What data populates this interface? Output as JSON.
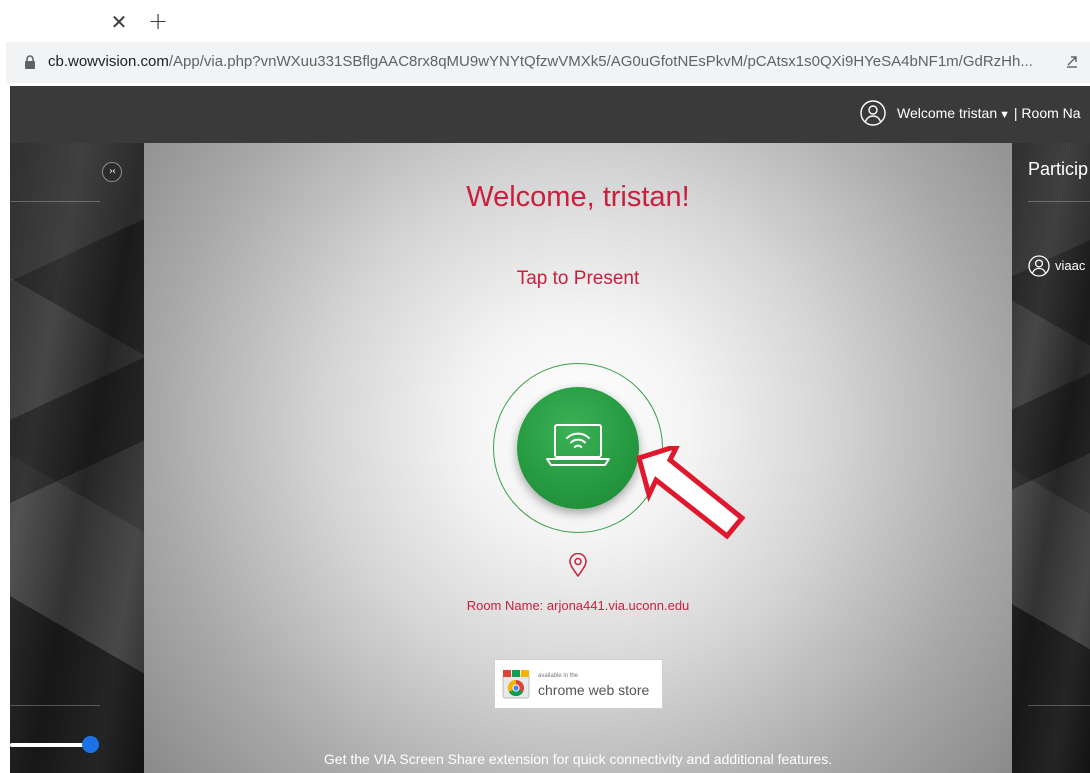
{
  "browser": {
    "url_host": "cb.wowvision.com",
    "url_path": "/App/via.php?vnWXuu331SBflgAAC8rx8qMU9wYNYtQfzwVMXk5/AG0uGfotNEsPkvM/pCAtsx1s0QXi9HYeSA4bNF1m/GdRzHh..."
  },
  "header": {
    "welcome_text": "Welcome  tristan",
    "room_text": "| Room Na"
  },
  "participants": {
    "title": "Particip",
    "items": [
      "viaac"
    ]
  },
  "main": {
    "welcome_title": "Welcome, tristan!",
    "tap_label": "Tap to Present",
    "room_name": "Room Name: arjona441.via.uconn.edu",
    "badge_small": "available in the",
    "badge_big": "chrome web store",
    "footer_note": "Get the VIA Screen Share extension for quick connectivity and additional features."
  },
  "colors": {
    "accent_red": "#c8203e",
    "present_green": "#269b42",
    "slider_blue": "#1a73e8",
    "header_bg": "#3a3a3a"
  },
  "volume_slider": {
    "value_fraction": 0.9
  }
}
